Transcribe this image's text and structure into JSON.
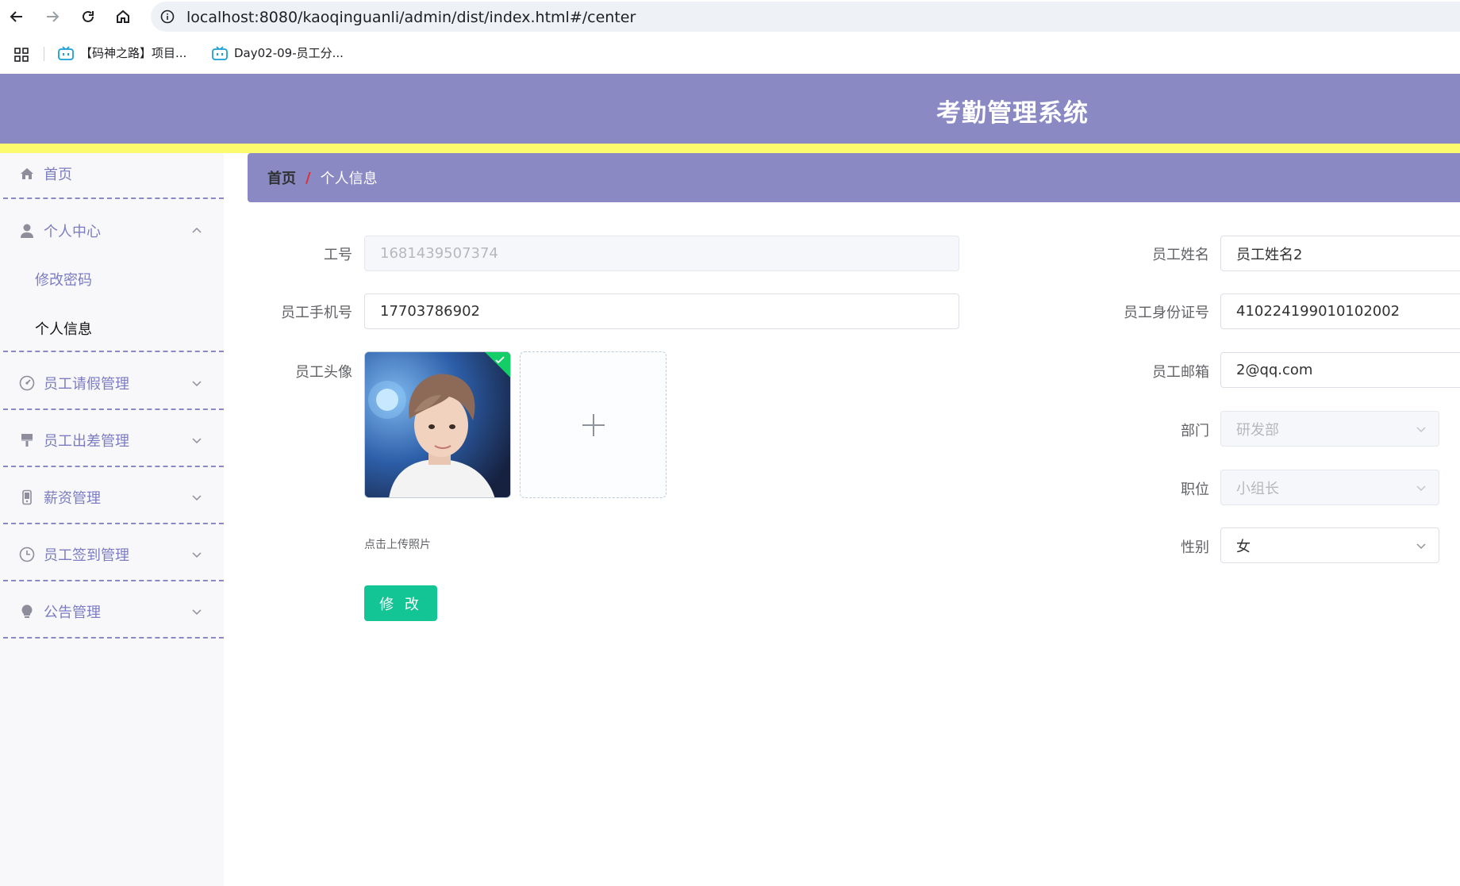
{
  "browser": {
    "url": "localhost:8080/kaoqinguanli/admin/dist/index.html#/center",
    "bookmarks": [
      {
        "label": "【码神之路】项目..."
      },
      {
        "label": "Day02-09-员工分..."
      }
    ]
  },
  "app": {
    "title": "考勤管理系统"
  },
  "sidebar": {
    "items": [
      {
        "label": "首页",
        "icon": "home-icon"
      },
      {
        "label": "个人中心",
        "icon": "user-icon",
        "expanded": true
      },
      {
        "label": "员工请假管理",
        "icon": "dashboard-icon"
      },
      {
        "label": "员工出差管理",
        "icon": "brush-icon"
      },
      {
        "label": "薪资管理",
        "icon": "mobile-icon"
      },
      {
        "label": "员工签到管理",
        "icon": "clock-icon"
      },
      {
        "label": "公告管理",
        "icon": "bulb-icon"
      }
    ],
    "sub_items": [
      {
        "label": "修改密码"
      },
      {
        "label": "个人信息",
        "active": true
      }
    ]
  },
  "breadcrumb": {
    "home": "首页",
    "separator": "/",
    "current": "个人信息"
  },
  "form": {
    "gonghao": {
      "label": "工号",
      "value": "1681439507374"
    },
    "name": {
      "label": "员工姓名",
      "value": "员工姓名2"
    },
    "phone": {
      "label": "员工手机号",
      "value": "17703786902"
    },
    "idcard": {
      "label": "员工身份证号",
      "value": "410224199010102002"
    },
    "avatar": {
      "label": "员工头像",
      "tip": "点击上传照片"
    },
    "email": {
      "label": "员工邮箱",
      "value": "2@qq.com"
    },
    "dept": {
      "label": "部门",
      "value": "研发部"
    },
    "position": {
      "label": "职位",
      "value": "小组长"
    },
    "gender": {
      "label": "性别",
      "value": "女"
    },
    "submit_label": "修 改"
  },
  "colors": {
    "header": "#8a89c4",
    "strip": "#fbfb6d",
    "menu_text": "#7c7cc2",
    "submit": "#13c594",
    "breadcrumb_sep": "#e02d2d"
  }
}
